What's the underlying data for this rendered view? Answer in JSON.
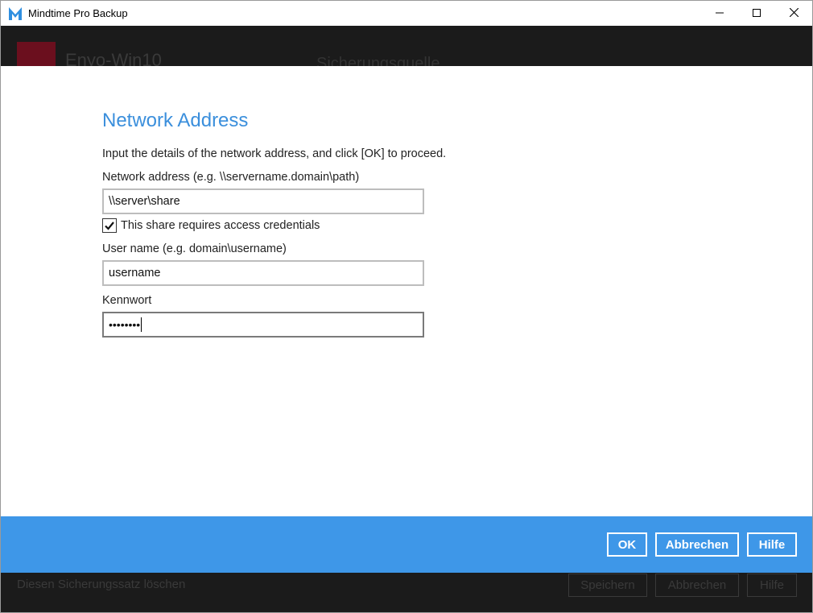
{
  "window": {
    "title": "Mindtime Pro Backup",
    "controls": [
      "minimize-icon",
      "maximize-icon",
      "close-icon"
    ]
  },
  "background": {
    "backup_set_name": "Enyo-Win10",
    "section_title": "Sicherungsquelle",
    "delete_link": "Diesen Sicherungssatz löschen",
    "buttons": [
      "Speichern",
      "Abbrechen",
      "Hilfe"
    ]
  },
  "dialog": {
    "title": "Network Address",
    "intro": "Input the details of the network address, and click [OK] to proceed.",
    "network_address_label": "Network address (e.g. \\\\servername.domain\\path)",
    "network_address_value": "\\\\server\\share",
    "credentials_checkbox_label": "This share requires access credentials",
    "credentials_checked": true,
    "username_label": "User name (e.g. domain\\username)",
    "username_value": "username",
    "password_label": "Kennwort",
    "password_masked": "••••••••"
  },
  "footer": {
    "ok_label": "OK",
    "cancel_label": "Abbrechen",
    "help_label": "Hilfe"
  },
  "colors": {
    "accent": "#3e97e8",
    "title_blue": "#3b8fdc",
    "backdrop": "#1b1b1b"
  }
}
